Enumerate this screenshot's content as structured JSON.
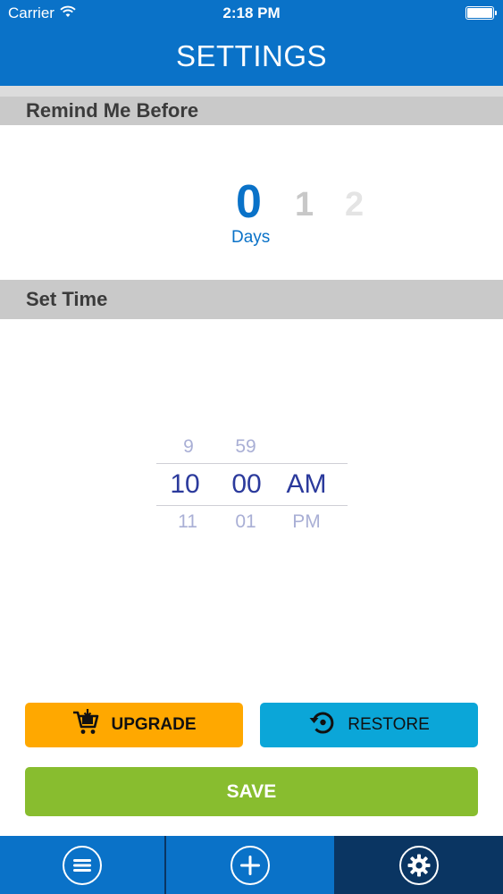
{
  "status_bar": {
    "carrier": "Carrier",
    "time": "2:18 PM",
    "battery_level": 1.0
  },
  "header": {
    "title": "SETTINGS"
  },
  "remind_section": {
    "title": "Remind Me Before",
    "days_picker": {
      "options": [
        "0",
        "1",
        "2"
      ],
      "selected": "0",
      "unit": "Days"
    }
  },
  "time_section": {
    "title": "Set Time",
    "hours": {
      "prev": "9",
      "selected": "10",
      "next": "11"
    },
    "minutes": {
      "prev": "59",
      "selected": "00",
      "next": "01"
    },
    "period": {
      "selected": "AM",
      "next": "PM"
    }
  },
  "buttons": {
    "upgrade": "UPGRADE",
    "restore": "RESTORE",
    "save": "SAVE"
  },
  "tab_bar": {
    "items": [
      {
        "icon": "menu-icon",
        "active": false
      },
      {
        "icon": "add-icon",
        "active": false
      },
      {
        "icon": "settings-gear-icon",
        "active": true
      }
    ]
  },
  "colors": {
    "primary": "#0a72c8",
    "dark_tab": "#0a3562",
    "upgrade": "#ffa800",
    "restore": "#0ba6d8",
    "save": "#88bd2f",
    "section_header": "#c9c9c9"
  }
}
